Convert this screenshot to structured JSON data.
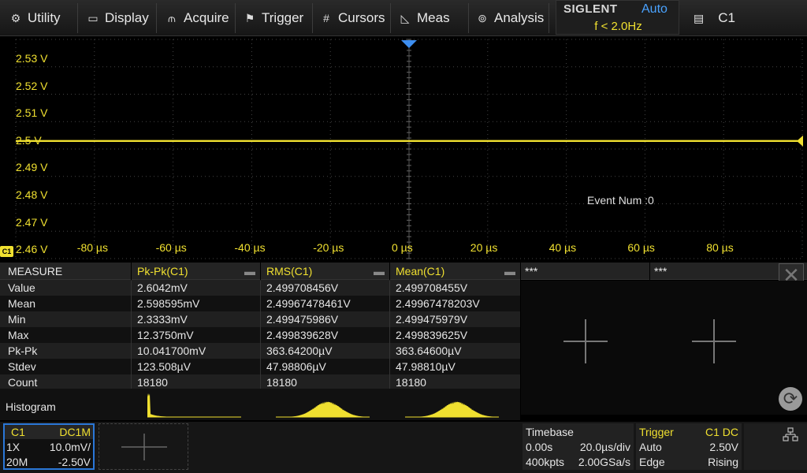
{
  "menu": {
    "items": [
      {
        "label": "Utility",
        "icon": "gear-icon",
        "glyph": "⚙"
      },
      {
        "label": "Display",
        "icon": "monitor-icon",
        "glyph": "▭"
      },
      {
        "label": "Acquire",
        "icon": "acquire-icon",
        "glyph": "⫙"
      },
      {
        "label": "Trigger",
        "icon": "flag-icon",
        "glyph": "⚑"
      },
      {
        "label": "Cursors",
        "icon": "cursor-cross-icon",
        "glyph": "#"
      },
      {
        "label": "Meas",
        "icon": "measure-icon",
        "glyph": "◺"
      },
      {
        "label": "Analysis",
        "icon": "analysis-icon",
        "glyph": "⊚"
      }
    ],
    "brand": "SIGLENT",
    "trigger_mode": "Auto",
    "trigger_frequency": "f < 2.0Hz",
    "channel_selector": "C1",
    "channel_icon": "document-icon"
  },
  "waveform": {
    "volt_labels": [
      "2.53 V",
      "2.52 V",
      "2.51 V",
      "2.5 V",
      "2.49 V",
      "2.48 V",
      "2.47 V",
      "2.46 V"
    ],
    "time_labels": [
      "-80 µs",
      "-60 µs",
      "-40 µs",
      "-20 µs",
      "0 µs",
      "20 µs",
      "40 µs",
      "60 µs",
      "80 µs"
    ],
    "event_text": "Event Num :0",
    "channel_marker": "C1",
    "trace_color": "#f0e030",
    "trace_level_v": 2.4997,
    "volt_top": 2.53,
    "volt_step": 0.01
  },
  "measure": {
    "headers": [
      "MEASURE",
      "Pk-Pk(C1)",
      "RMS(C1)",
      "Mean(C1)",
      "***",
      "***"
    ],
    "rows": [
      [
        "Value",
        "2.6042mV",
        "2.499708456V",
        "2.499708455V"
      ],
      [
        "Mean",
        "2.598595mV",
        "2.49967478461V",
        "2.49967478203V"
      ],
      [
        "Min",
        "2.3333mV",
        "2.499475986V",
        "2.499475979V"
      ],
      [
        "Max",
        "12.3750mV",
        "2.499839628V",
        "2.499839625V"
      ],
      [
        "Pk-Pk",
        "10.041700mV",
        "363.64200µV",
        "363.64600µV"
      ],
      [
        "Stdev",
        "123.508µV",
        "47.98806µV",
        "47.98810µV"
      ],
      [
        "Count",
        "18180",
        "18180",
        "18180"
      ]
    ],
    "histogram_label": "Histogram"
  },
  "status": {
    "channel": {
      "name": "C1",
      "coupling": "DC1M",
      "probe": "1X",
      "scale": "10.0mV/",
      "bandwidth": "20M",
      "offset": "-2.50V"
    },
    "timebase": {
      "title": "Timebase",
      "delay": "0.00s",
      "scale": "20.0µs/div",
      "memory": "400kpts",
      "sample_rate": "2.00GSa/s"
    },
    "trigger": {
      "title": "Trigger",
      "source": "C1 DC",
      "mode": "Auto",
      "level": "2.50V",
      "type": "Edge",
      "slope": "Rising"
    }
  }
}
